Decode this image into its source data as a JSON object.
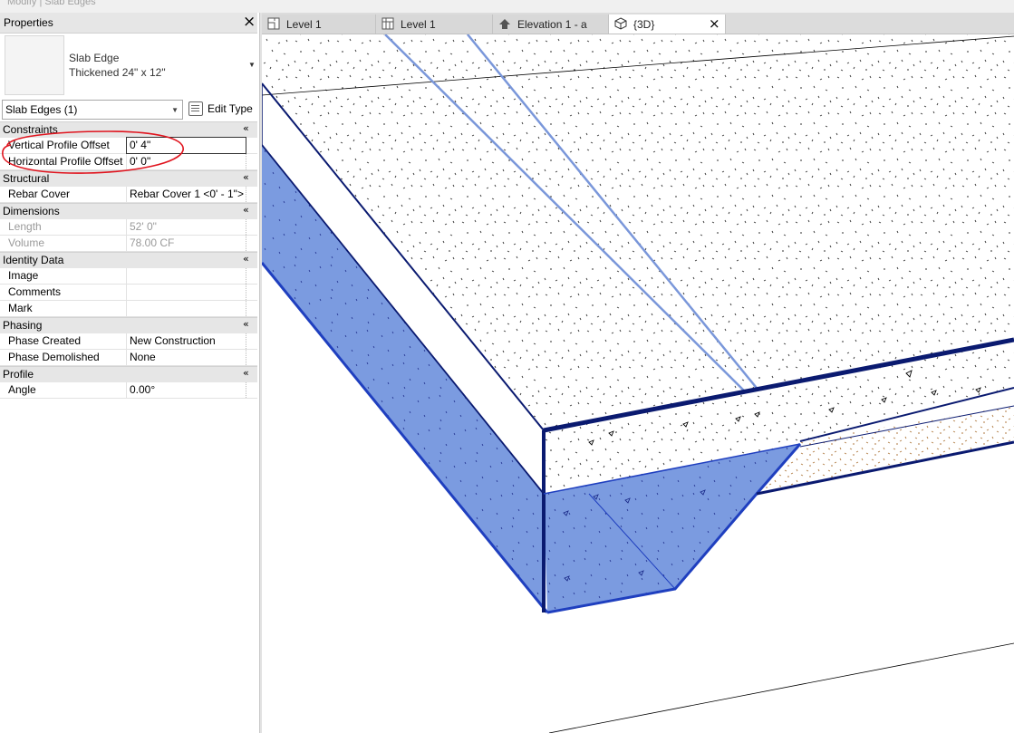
{
  "window": {
    "ribbon_context": "Modify | Slab Edges"
  },
  "properties": {
    "title": "Properties",
    "type_name": "Slab Edge",
    "type_sub": "Thickened 24\" x 12\"",
    "filter": "Slab Edges (1)",
    "edit_type": "Edit Type",
    "groups": {
      "constraints": "Constraints",
      "structural": "Structural",
      "dimensions": "Dimensions",
      "identity": "Identity Data",
      "phasing": "Phasing",
      "profile": "Profile"
    },
    "collapse_glyph": "«",
    "rows": {
      "vertical_profile_offset": {
        "label": "Vertical Profile Offset",
        "value": "0'  4\""
      },
      "horizontal_profile_offset": {
        "label": "Horizontal Profile Offset",
        "value": "0'  0\""
      },
      "rebar_cover": {
        "label": "Rebar Cover",
        "value": "Rebar Cover 1 <0' - 1\">"
      },
      "length": {
        "label": "Length",
        "value": "52'  0\""
      },
      "volume": {
        "label": "Volume",
        "value": "78.00 CF"
      },
      "image": {
        "label": "Image",
        "value": ""
      },
      "comments": {
        "label": "Comments",
        "value": ""
      },
      "mark": {
        "label": "Mark",
        "value": ""
      },
      "phase_created": {
        "label": "Phase Created",
        "value": "New Construction"
      },
      "phase_demolished": {
        "label": "Phase Demolished",
        "value": "None"
      },
      "angle": {
        "label": "Angle",
        "value": "0.00°"
      }
    }
  },
  "tabs": [
    {
      "label": "Level 1",
      "icon": "floor-plan-icon"
    },
    {
      "label": "Level 1",
      "icon": "ceiling-plan-icon"
    },
    {
      "label": "Elevation 1 - a",
      "icon": "elevation-icon"
    },
    {
      "label": "{3D}",
      "icon": "3d-view-icon"
    }
  ],
  "colors": {
    "selection_blue": "#1f3fbf",
    "edge_dark": "#0a1a70",
    "fill_blue": "#7b9be0",
    "annotation_red": "#e0141e"
  }
}
